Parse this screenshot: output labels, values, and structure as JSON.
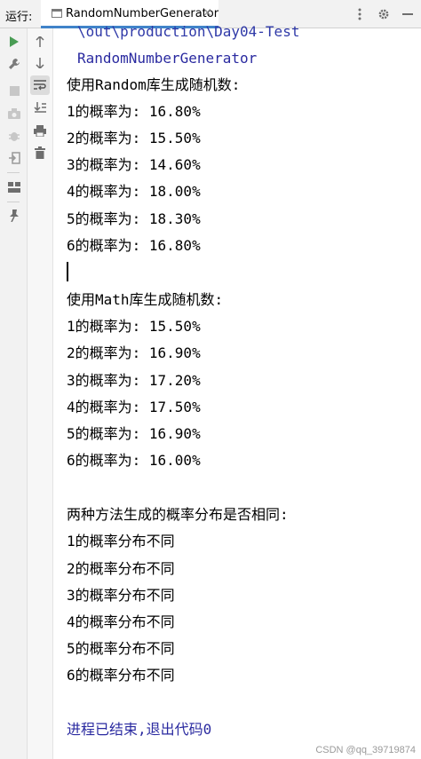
{
  "topbar": {
    "run_label": "运行:",
    "tab_title": "RandomNumberGenerator",
    "tab_close": "×",
    "icons": [
      "more-vertical-icon",
      "gear-icon",
      "minimize-icon"
    ]
  },
  "console": {
    "lines": [
      "\\out\\production\\Day04-Test",
      "RandomNumberGenerator",
      "使用Random库生成随机数:",
      "1的概率为: 16.80%",
      "2的概率为: 15.50%",
      "3的概率为: 14.60%",
      "4的概率为: 18.00%",
      "5的概率为: 18.30%",
      "6的概率为: 16.80%",
      "使用Math库生成随机数:",
      "1的概率为: 15.50%",
      "2的概率为: 16.90%",
      "3的概率为: 17.20%",
      "4的概率为: 17.50%",
      "5的概率为: 16.90%",
      "6的概率为: 16.00%",
      "两种方法生成的概率分布是否相同:",
      "1的概率分布不同",
      "2的概率分布不同",
      "3的概率分布不同",
      "4的概率分布不同",
      "5的概率分布不同",
      "6的概率分布不同",
      "进程已结束,退出代码0"
    ]
  },
  "watermark": "CSDN @qq_39719874",
  "colors": {
    "run_green": "#499c54",
    "link_blue": "#2f39a8",
    "tab_accent": "#4083c9"
  }
}
